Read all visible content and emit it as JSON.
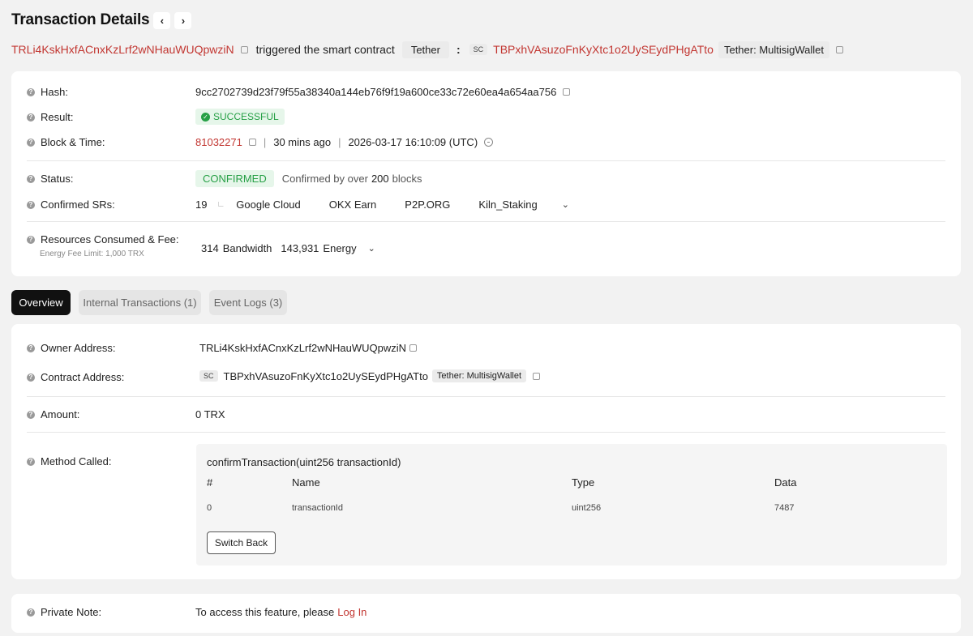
{
  "header": {
    "title": "Transaction Details",
    "prev": "‹",
    "next": "›"
  },
  "subline": {
    "from_address": "TRLi4KskHxfACnxKzLrf2wNHauWUQpwziN",
    "action": "triggered the smart contract",
    "token_tag": "Tether",
    "colon": ":",
    "sc_tag": "SC",
    "contract_address": "TBPxhVAsuzoFnKyXtc1o2UySEydPHgATto",
    "contract_tag": "Tether: MultisigWallet"
  },
  "summary": {
    "hash_label": "Hash:",
    "hash_value": "9cc2702739d23f79f55a38340a144eb76f9f19a600ce33c72e60ea4a654aa756",
    "result_label": "Result:",
    "result_value": "SUCCESSFUL",
    "block_label": "Block & Time:",
    "block_number": "81032271",
    "time_ago": "30 mins ago",
    "sep": "|",
    "timestamp": "2026-03-17 16:10:09 (UTC)",
    "status_label": "Status:",
    "status_value": "CONFIRMED",
    "confirmed_prefix": "Confirmed by over",
    "confirmed_blocks": "200",
    "confirmed_suffix": "blocks",
    "srs_label": "Confirmed SRs:",
    "srs_count": "19",
    "srs_corner": "∟",
    "srs": [
      "Google Cloud",
      "OKX Earn",
      "P2P.ORG",
      "Kiln_Staking"
    ],
    "resources_label": "Resources Consumed & Fee:",
    "energy_fee_limit": "Energy Fee Limit: 1,000 TRX",
    "bandwidth_value": "314",
    "bandwidth_label": "Bandwidth",
    "energy_value": "143,931",
    "energy_label": "Energy"
  },
  "tabs": [
    {
      "label": "Overview"
    },
    {
      "label": "Internal Transactions (1)"
    },
    {
      "label": "Event Logs (3)"
    }
  ],
  "overview": {
    "owner_label": "Owner Address:",
    "owner_value": "TRLi4KskHxfACnxKzLrf2wNHauWUQpwziN",
    "contract_label": "Contract Address:",
    "contract_sc": "SC",
    "contract_value": "TBPxhVAsuzoFnKyXtc1o2UySEydPHgATto",
    "contract_tag": "Tether: MultisigWallet",
    "amount_label": "Amount:",
    "amount_value": "0 TRX",
    "method_label": "Method Called:",
    "method_signature": "confirmTransaction(uint256 transactionId)",
    "table_headers": [
      "#",
      "Name",
      "Type",
      "Data"
    ],
    "table_row": [
      "0",
      "transactionId",
      "uint256",
      "7487"
    ],
    "switch_button": "Switch Back"
  },
  "note": {
    "label": "Private Note:",
    "text": "To access this feature, please",
    "link": "Log In"
  },
  "icons": {
    "help": "?",
    "chevron_down": "⌄",
    "check": "✓"
  },
  "colors": {
    "accent_red": "#c23631",
    "success_green": "#27a046",
    "tab_active": "#111111"
  }
}
